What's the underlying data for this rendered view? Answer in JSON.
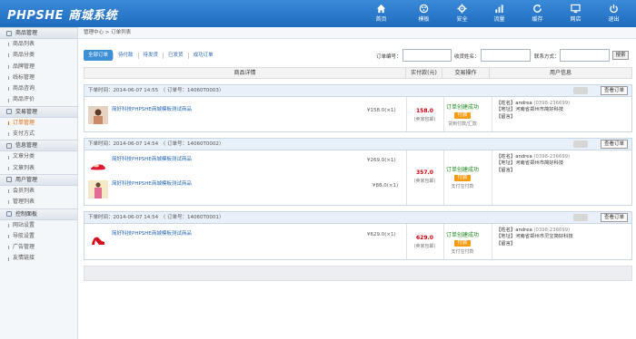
{
  "brand": {
    "logo": "PHPSHE 商城系统"
  },
  "nav": [
    {
      "label": "首页",
      "icon": "home-icon"
    },
    {
      "label": "模板",
      "icon": "template-icon"
    },
    {
      "label": "安全",
      "icon": "security-icon"
    },
    {
      "label": "流量",
      "icon": "chart-icon"
    },
    {
      "label": "缓存",
      "icon": "refresh-icon"
    },
    {
      "label": "网店",
      "icon": "monitor-icon"
    },
    {
      "label": "退出",
      "icon": "power-icon"
    }
  ],
  "sidebar": {
    "sections": [
      {
        "title": "商品管理",
        "items": [
          "商品列表",
          "商品分类",
          "品牌管理",
          "线标管理",
          "商品咨询",
          "商品评价"
        ]
      },
      {
        "title": "交易管理",
        "items": [
          "订单管理",
          "支付方式"
        ]
      },
      {
        "title": "信息管理",
        "items": [
          "文章分类",
          "文章列表"
        ]
      },
      {
        "title": "用户管理",
        "items": [
          "会员列表",
          "管理列表"
        ]
      },
      {
        "title": "控制面板",
        "items": [
          "网站设置",
          "导航设置",
          "广告管理",
          "友情链接"
        ]
      }
    ],
    "active_item": "订单管理"
  },
  "breadcrumb": "管理中心 > 订单列表",
  "filters": {
    "tabs": [
      "全部订单",
      "待付款",
      "待发货",
      "已发货",
      "成功订单"
    ],
    "order_no_label": "订单编号：",
    "order_no_value": "",
    "receiver_label": "收货姓名：",
    "receiver_value": "",
    "contact_label": "联系方式：",
    "contact_value": "",
    "search_label": "搜索"
  },
  "table_headers": [
    "商品详情",
    "实付款(元)",
    "交易操作",
    "用户信息"
  ],
  "orders": [
    {
      "head": "下单时间：2014-06-07 14:55　〈 订单号：14060T0003〉",
      "view": "查看订单",
      "products": [
        {
          "name": "简好科技PHPSHE商城模板测试商品",
          "price": "¥158.0(×1)"
        }
      ],
      "amount": "158.0",
      "shipping": "(卖家包邮)",
      "status": "订单创建成功",
      "pay": "付款",
      "method": "货到付款/汇款",
      "user": {
        "name_label": "【姓名】",
        "name": "andrea",
        "phone": "(0398-236699)",
        "addr_label": "【地址】",
        "addr": "河南省郑州市简好科技",
        "note_label": "【留言】"
      }
    },
    {
      "head": "下单时间：2014-06-07 14:54　〈 订单号：14060T0002〉",
      "view": "查看订单",
      "products": [
        {
          "name": "简好科技PHPSHE商城模板测试商品",
          "price": "¥269.0(×1)"
        },
        {
          "name": "简好科技PHPSHE商城模板测试商品",
          "price": "¥88.0(×1)"
        }
      ],
      "amount": "357.0",
      "shipping": "(卖家包邮)",
      "status": "订单创建成功",
      "pay": "付款",
      "method": "支付宝付款",
      "user": {
        "name_label": "【姓名】",
        "name": "andrea",
        "phone": "(0398-236699)",
        "addr_label": "【地址】",
        "addr": "河南省郑州市简好科技",
        "note_label": "【留言】"
      }
    },
    {
      "head": "下单时间：2014-06-07 14:54　〈 订单号：14060T0001〉",
      "view": "查看订单",
      "products": [
        {
          "name": "简好科技PHPSHE商城模板测试商品",
          "price": "¥629.0(×1)"
        }
      ],
      "amount": "629.0",
      "shipping": "(卖家包邮)",
      "status": "订单创建成功",
      "pay": "付款",
      "method": "支付宝付款",
      "user": {
        "name_label": "【姓名】",
        "name": "andrea",
        "phone": "(0398-236699)",
        "addr_label": "【地址】",
        "addr": "河南省郑州市灵宝简好科技",
        "note_label": "【留言】"
      }
    }
  ],
  "colors": {
    "topbar": "#2a7ccd",
    "accent": "#3d8fd6",
    "price_red": "#d4000c",
    "status_green": "#1f8a1f",
    "pay_orange": "#f49c13",
    "active_orange": "#e8670a"
  }
}
